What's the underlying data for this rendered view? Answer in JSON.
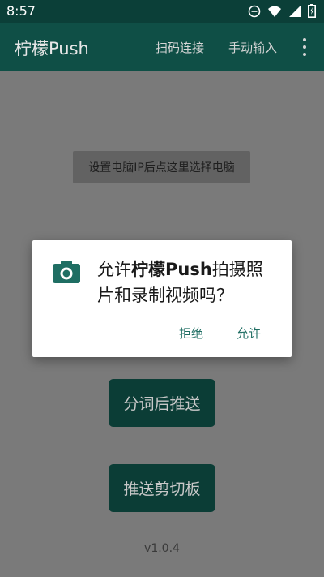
{
  "status_bar": {
    "time": "8:57",
    "icons": [
      "do-not-disturb-icon",
      "wifi-icon",
      "signal-icon",
      "battery-charging-icon"
    ]
  },
  "app_bar": {
    "title": "柠檬Push",
    "actions": [
      "扫码连接",
      "手动输入"
    ],
    "overflow_icon": "more-vert-icon"
  },
  "main": {
    "ip_button_label": "设置电脑IP后点这里选择电脑",
    "segment_button_label": "分词后推送",
    "clipboard_button_label": "推送剪切板",
    "version": "v1.0.4"
  },
  "dialog": {
    "icon": "camera-icon",
    "message_prefix": "允许",
    "message_app": "柠檬Push",
    "message_suffix": "拍摄照片和录制视频吗？",
    "deny_label": "拒绝",
    "allow_label": "允许"
  },
  "colors": {
    "app_bar": "#0f4f46",
    "status_bar": "#0b3f38",
    "accent": "#1f6e63",
    "scrim_background": "#7a7a7a",
    "dialog_background": "#ffffff"
  }
}
